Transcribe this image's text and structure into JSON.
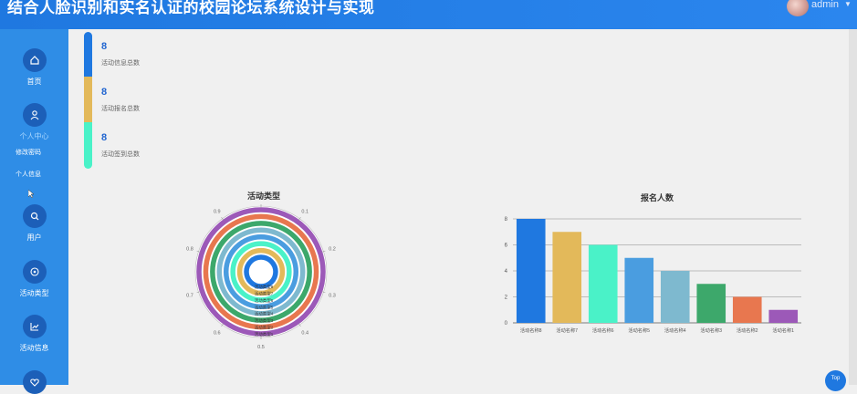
{
  "header": {
    "title": "结合人脸识别和实名认证的校园论坛系统设计与实现",
    "username": "admin",
    "caret": "▼"
  },
  "sidebar": {
    "items": [
      {
        "label": "首页",
        "icon": "home-icon"
      },
      {
        "label": "个人中心",
        "icon": "person-icon"
      },
      {
        "label": "用户",
        "icon": "search-icon"
      },
      {
        "label": "活动类型",
        "icon": "plus-circle-icon"
      },
      {
        "label": "活动信息",
        "icon": "chart-icon"
      }
    ],
    "subitems": [
      {
        "label": "修改密码"
      },
      {
        "label": "个人信息"
      }
    ],
    "active_color": "#7fc3ff"
  },
  "stats": [
    {
      "value": "8",
      "label": "活动信息总数",
      "color": "#1f78e0"
    },
    {
      "value": "8",
      "label": "活动报名总数",
      "color": "#e3b95a"
    },
    {
      "value": "8",
      "label": "活动签到总数",
      "color": "#4af2c8"
    }
  ],
  "chart_data": [
    {
      "type": "polar-bar",
      "title": "活动类型",
      "angle_ticks": [
        "0",
        "0.1",
        "0.2",
        "0.3",
        "0.4",
        "0.5",
        "0.6",
        "0.7",
        "0.8",
        "0.9"
      ],
      "categories": [
        "活动类型1",
        "活动类型2",
        "活动类型3",
        "活动类型4",
        "活动类型5",
        "活动类型6",
        "活动类型7",
        "活动类型8"
      ],
      "values": [
        1,
        1,
        1,
        1,
        1,
        1,
        1,
        1
      ],
      "colors": [
        "#9c59b8",
        "#e8774f",
        "#3da86b",
        "#7eb9cf",
        "#4a9de0",
        "#4af2c8",
        "#e3b95a",
        "#1f78e0"
      ]
    },
    {
      "type": "bar",
      "title": "报名人数",
      "categories": [
        "活动名称8",
        "活动名称7",
        "活动名称6",
        "活动名称5",
        "活动名称4",
        "活动名称3",
        "活动名称2",
        "活动名称1"
      ],
      "values": [
        8,
        7,
        6,
        5,
        4,
        3,
        2,
        1
      ],
      "ylim": [
        0,
        8
      ],
      "yticks": [
        0,
        2,
        4,
        6,
        8
      ],
      "colors": [
        "#1f78e0",
        "#e3b95a",
        "#4af2c8",
        "#4a9de0",
        "#7eb9cf",
        "#3da86b",
        "#e8774f",
        "#9c59b8"
      ]
    }
  ],
  "top_button": {
    "label": "Top"
  }
}
